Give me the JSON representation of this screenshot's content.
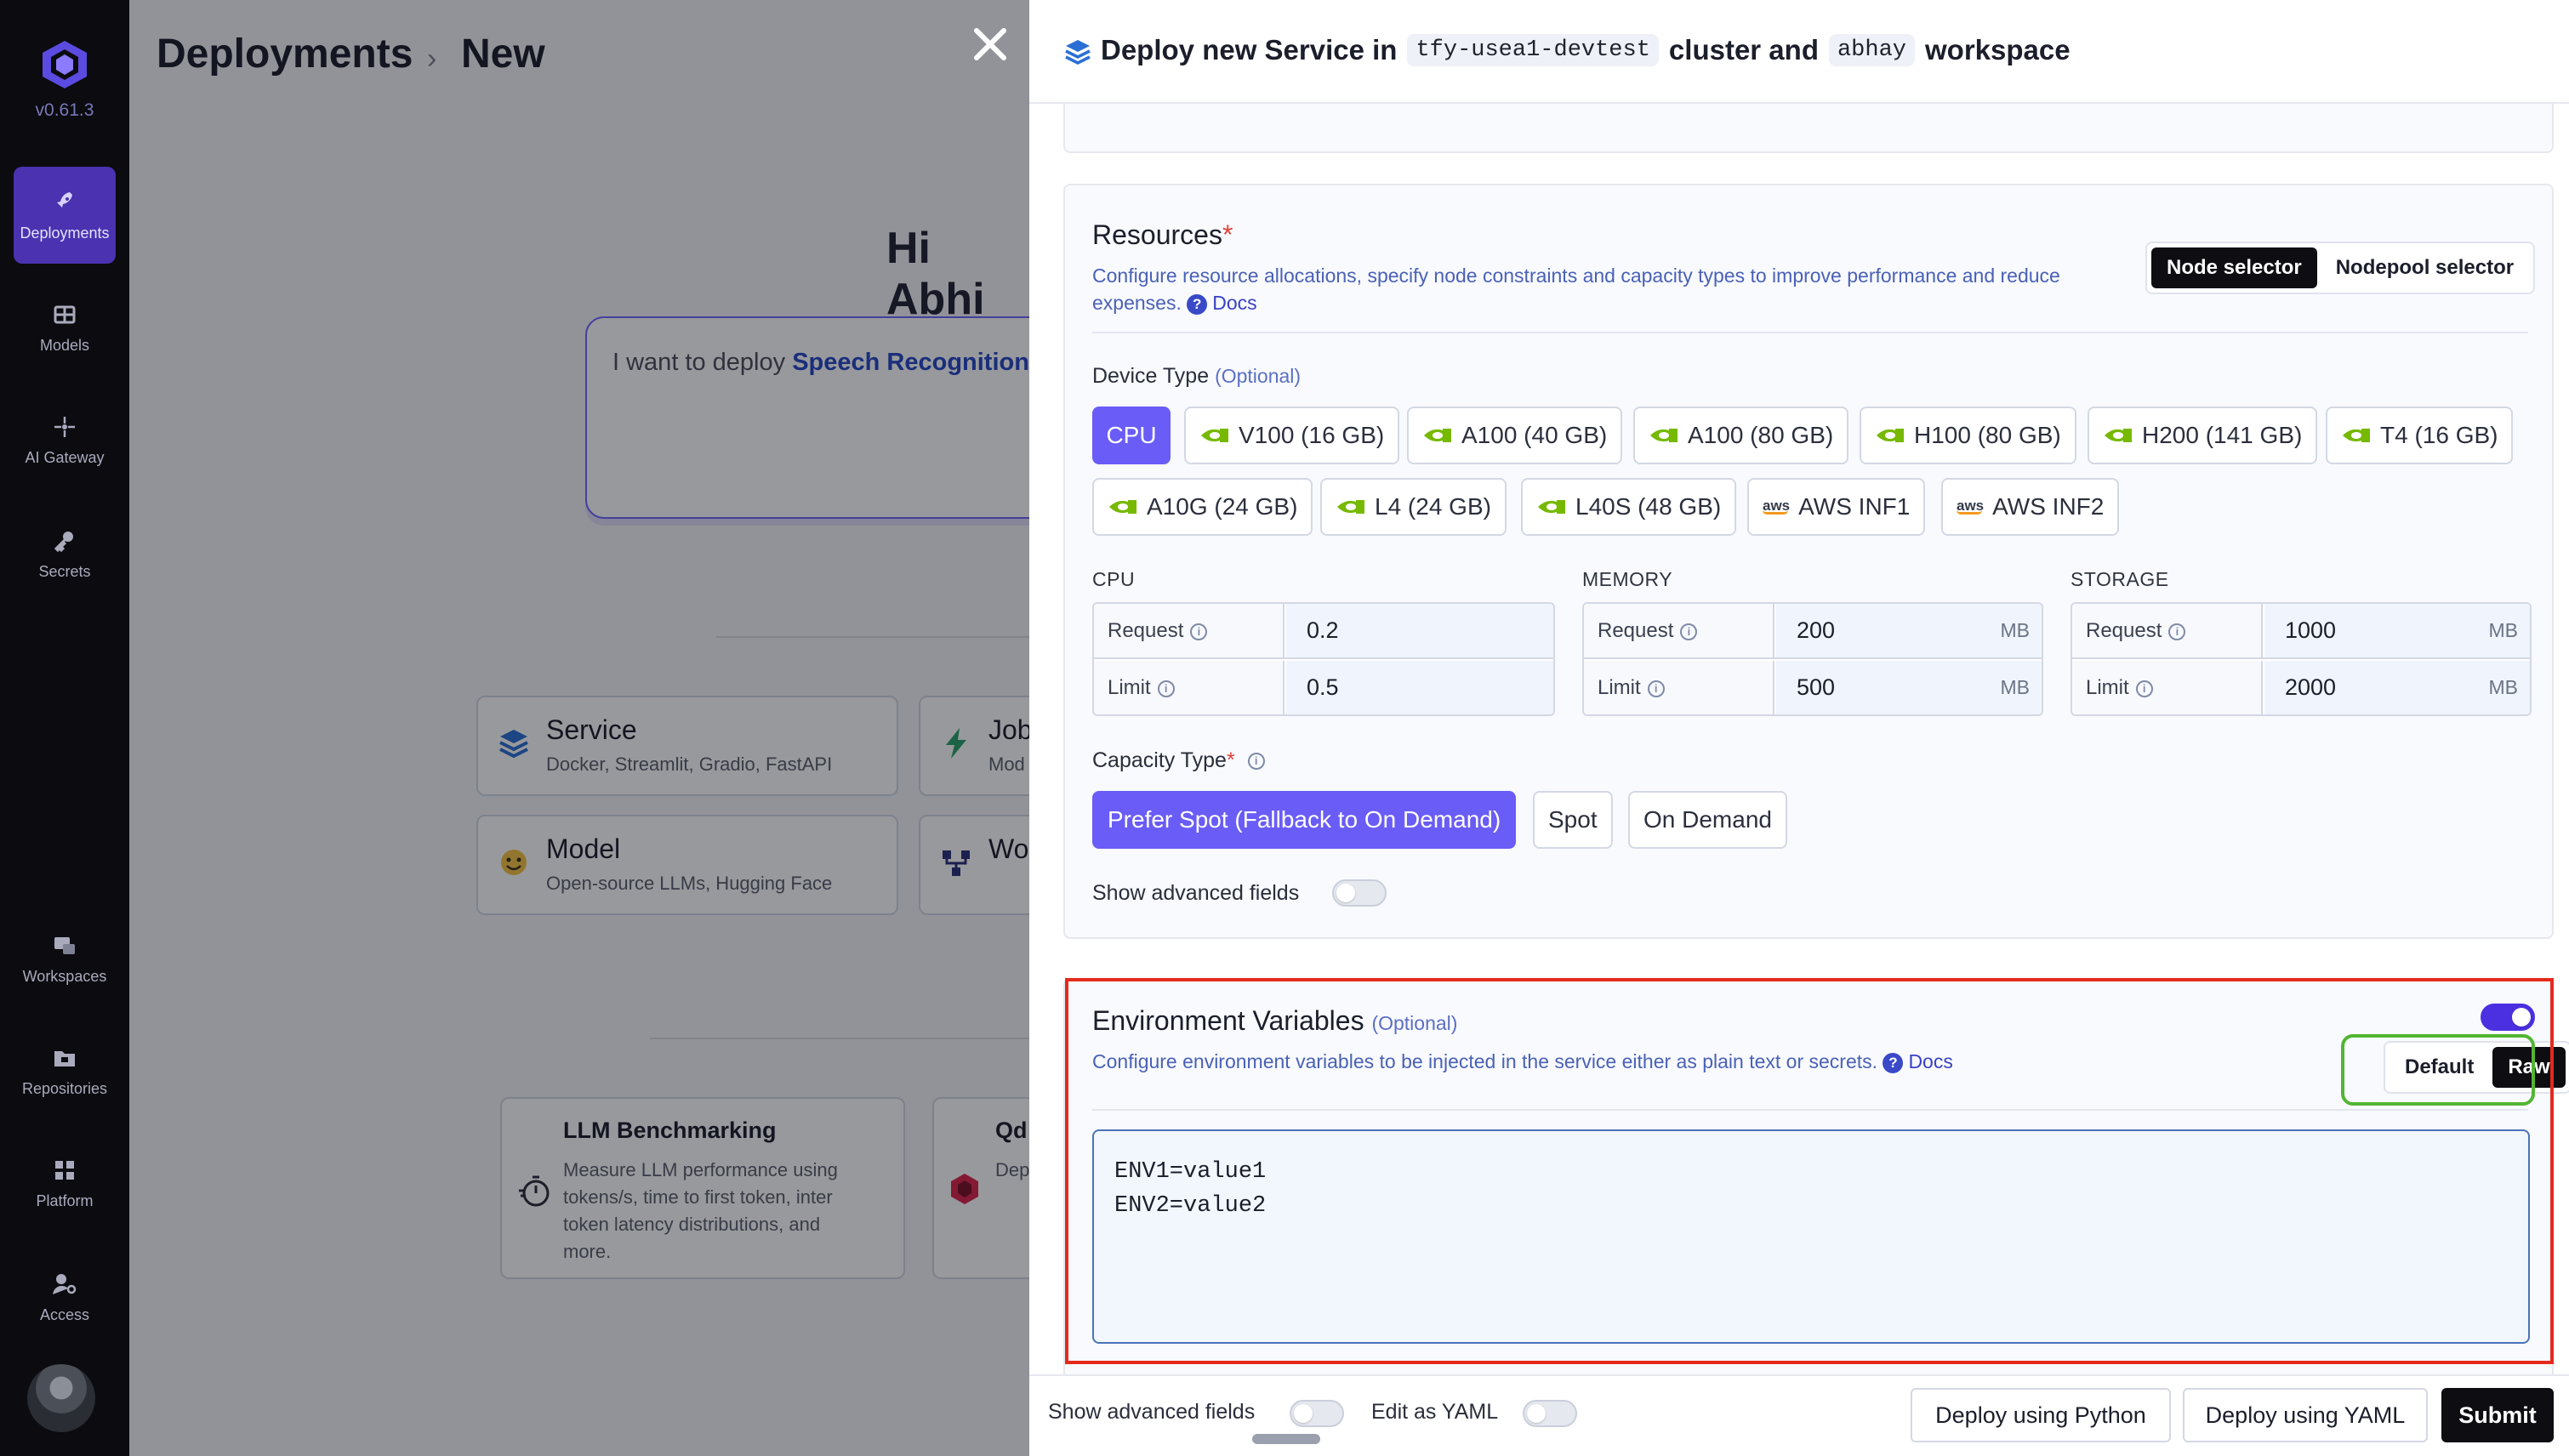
{
  "sidebar": {
    "version": "v0.61.3",
    "items": [
      {
        "label": "Deployments",
        "icon": "rocket-icon"
      },
      {
        "label": "Models",
        "icon": "grid-icon"
      },
      {
        "label": "AI Gateway",
        "icon": "gateway-icon"
      },
      {
        "label": "Secrets",
        "icon": "key-icon"
      },
      {
        "label": "Workspaces",
        "icon": "workspaces-icon"
      },
      {
        "label": "Repositories",
        "icon": "folder-icon"
      },
      {
        "label": "Platform",
        "icon": "platform-icon"
      },
      {
        "label": "Access",
        "icon": "user-key-icon"
      }
    ]
  },
  "background": {
    "breadcrumb": {
      "parent": "Deployments",
      "current": "New"
    },
    "greeting": "Hi Abhi",
    "prompt": {
      "prefix": "I want to deploy ",
      "highlight": "Speech Recognition"
    },
    "cards": [
      {
        "title": "Service",
        "subtitle": "Docker, Streamlit, Gradio, FastAPI"
      },
      {
        "title": "Job",
        "subtitle": "Mod"
      },
      {
        "title": "Model",
        "subtitle": "Open-source LLMs, Hugging Face"
      },
      {
        "title": "Wo",
        "subtitle": ""
      }
    ],
    "bench": [
      {
        "title": "LLM Benchmarking",
        "desc": "Measure LLM performance using tokens/s, time to first token, inter token latency distributions, and more."
      },
      {
        "title": "Qd",
        "desc": "Dep Sea"
      }
    ]
  },
  "drawer": {
    "title_prefix": "Deploy new Service in",
    "cluster": "tfy-usea1-devtest",
    "cluster_suffix": "cluster and",
    "workspace": "abhay",
    "workspace_suffix": "workspace",
    "resources": {
      "title": "Resources",
      "required_mark": "*",
      "description": "Configure resource allocations, specify node constraints and capacity types to improve performance and reduce expenses.",
      "docs_label": "Docs",
      "selector_tabs": [
        "Node selector",
        "Nodepool selector"
      ],
      "selected_selector": "Node selector",
      "device_type_label": "Device Type",
      "optional_label": "(Optional)",
      "devices": [
        "CPU",
        "V100 (16 GB)",
        "A100 (40 GB)",
        "A100 (80 GB)",
        "H100 (80 GB)",
        "H200 (141 GB)",
        "T4 (16 GB)",
        "A10G (24 GB)",
        "L4 (24 GB)",
        "L40S (48 GB)",
        "AWS INF1",
        "AWS INF2"
      ],
      "selected_device": "CPU",
      "cpu": {
        "header": "CPU",
        "request_label": "Request",
        "limit_label": "Limit",
        "request": "0.2",
        "limit": "0.5"
      },
      "memory": {
        "header": "MEMORY",
        "request_label": "Request",
        "limit_label": "Limit",
        "request": "200",
        "limit": "500",
        "unit": "MB"
      },
      "storage": {
        "header": "STORAGE",
        "request_label": "Request",
        "limit_label": "Limit",
        "request": "1000",
        "limit": "2000",
        "unit": "MB"
      },
      "capacity_label": "Capacity Type",
      "capacity_options": [
        "Prefer Spot (Fallback to On Demand)",
        "Spot",
        "On Demand"
      ],
      "selected_capacity": "Prefer Spot (Fallback to On Demand)",
      "advanced_label": "Show advanced fields"
    },
    "env": {
      "title": "Environment Variables",
      "optional_label": "(Optional)",
      "description": "Configure environment variables to be injected in the service either as plain text or secrets.",
      "docs_label": "Docs",
      "enabled": true,
      "mode_tabs": [
        "Default",
        "Raw"
      ],
      "selected_mode": "Raw",
      "value_lines": [
        "ENV1=value1",
        "ENV2=value2"
      ]
    },
    "footer": {
      "advanced_label": "Show advanced fields",
      "yaml_label": "Edit as YAML",
      "python_button": "Deploy using Python",
      "yaml_button": "Deploy using YAML",
      "submit_button": "Submit"
    }
  },
  "colors": {
    "accent": "#6a5cf6",
    "highlight_red": "#e52a1c",
    "highlight_green": "#52b533",
    "nvidia_green": "#76b900"
  }
}
